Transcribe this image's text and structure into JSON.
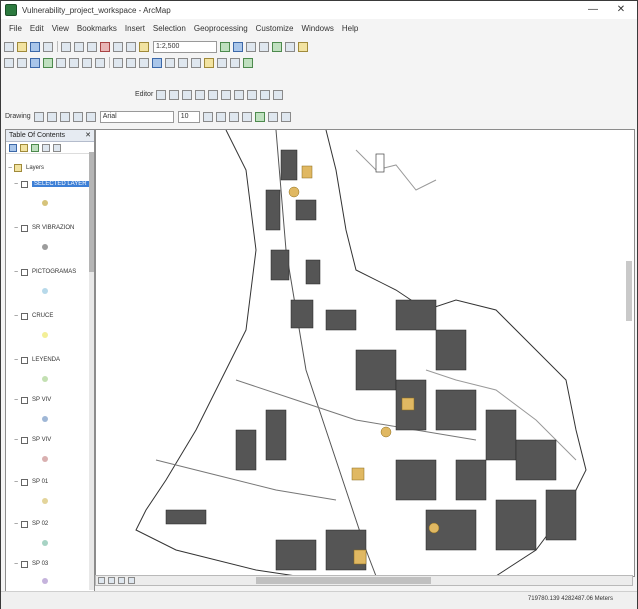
{
  "window": {
    "title": "Vulnerability_project_workspace - ArcMap",
    "minimize_icon": "minimize-icon",
    "close_icon": "close-icon"
  },
  "menu": [
    "File",
    "Edit",
    "View",
    "Bookmarks",
    "Insert",
    "Selection",
    "Geoprocessing",
    "Customize",
    "Windows",
    "Help"
  ],
  "toolbar": {
    "scale": "1:2,500",
    "editor_label": "Editor",
    "drawing_label": "Drawing",
    "font_name": "Arial",
    "font_size": "10"
  },
  "toc": {
    "title": "Table Of Contents",
    "close": "✕",
    "root_layer": "Layers",
    "layers": [
      {
        "name": "SELECTED LAYER",
        "selected": true,
        "color": "#d6c37a"
      },
      {
        "name": "SR VIBRAZION",
        "selected": false,
        "color": "#9c9c9c"
      },
      {
        "name": "PICTOGRAMAS",
        "selected": false,
        "color": "#b7d9ea"
      },
      {
        "name": "CRUCE",
        "selected": false,
        "color": "#f3ef97"
      },
      {
        "name": "LEYENDA",
        "selected": false,
        "color": "#c3e0b2"
      },
      {
        "name": "SP VIV",
        "selected": false,
        "color": "#9fb7d6"
      },
      {
        "name": "SP VIV",
        "selected": false,
        "color": "#d9b0b0"
      },
      {
        "name": "SP 01",
        "selected": false,
        "color": "#e3d49a"
      },
      {
        "name": "SP 02",
        "selected": false,
        "color": "#a7d3c4"
      },
      {
        "name": "SP 03",
        "selected": false,
        "color": "#c5b3dc"
      }
    ]
  },
  "colors": {
    "accent": "#3d7fd6",
    "map_line": "#333333",
    "map_marker": "#e0b862"
  },
  "status": {
    "coordinates": "719780.139  4282487.06 Meters"
  }
}
